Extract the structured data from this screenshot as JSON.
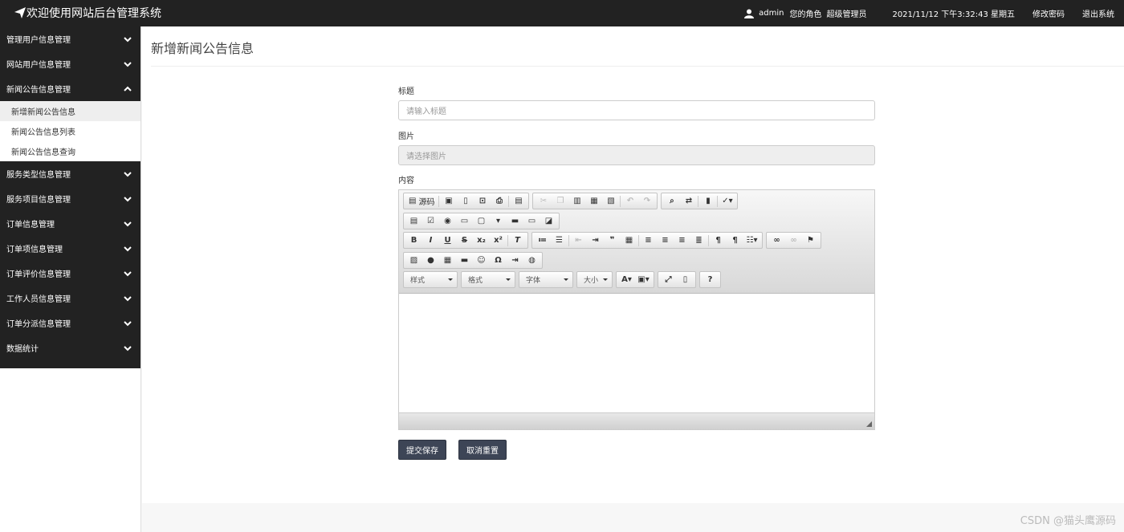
{
  "header": {
    "title": "欢迎使用网站后台管理系统",
    "username": "admin",
    "role_label": "您的角色",
    "role": "超级管理员",
    "datetime": "2021/11/12 下午3:32:43 星期五",
    "change_password": "修改密码",
    "logout": "退出系统"
  },
  "sidebar": {
    "items": [
      {
        "label": "管理用户信息管理"
      },
      {
        "label": "网站用户信息管理"
      },
      {
        "label": "新闻公告信息管理"
      },
      {
        "label": "服务类型信息管理"
      },
      {
        "label": "服务项目信息管理"
      },
      {
        "label": "订单信息管理"
      },
      {
        "label": "订单项信息管理"
      },
      {
        "label": "订单评价信息管理"
      },
      {
        "label": "工作人员信息管理"
      },
      {
        "label": "订单分派信息管理"
      },
      {
        "label": "数据统计"
      }
    ],
    "submenu": [
      {
        "label": "新增新闻公告信息"
      },
      {
        "label": "新闻公告信息列表"
      },
      {
        "label": "新闻公告信息查询"
      }
    ]
  },
  "main": {
    "page_title": "新增新闻公告信息",
    "fields": {
      "title_label": "标题",
      "title_placeholder": "请输入标题",
      "image_label": "图片",
      "image_placeholder": "请选择图片",
      "content_label": "内容"
    },
    "editor": {
      "source_label": "源码",
      "combos": {
        "style": "样式",
        "format": "格式",
        "font": "字体",
        "size": "大小"
      }
    },
    "buttons": {
      "submit": "提交保存",
      "reset": "取消重置"
    }
  },
  "watermark": "CSDN @猫头鹰源码"
}
